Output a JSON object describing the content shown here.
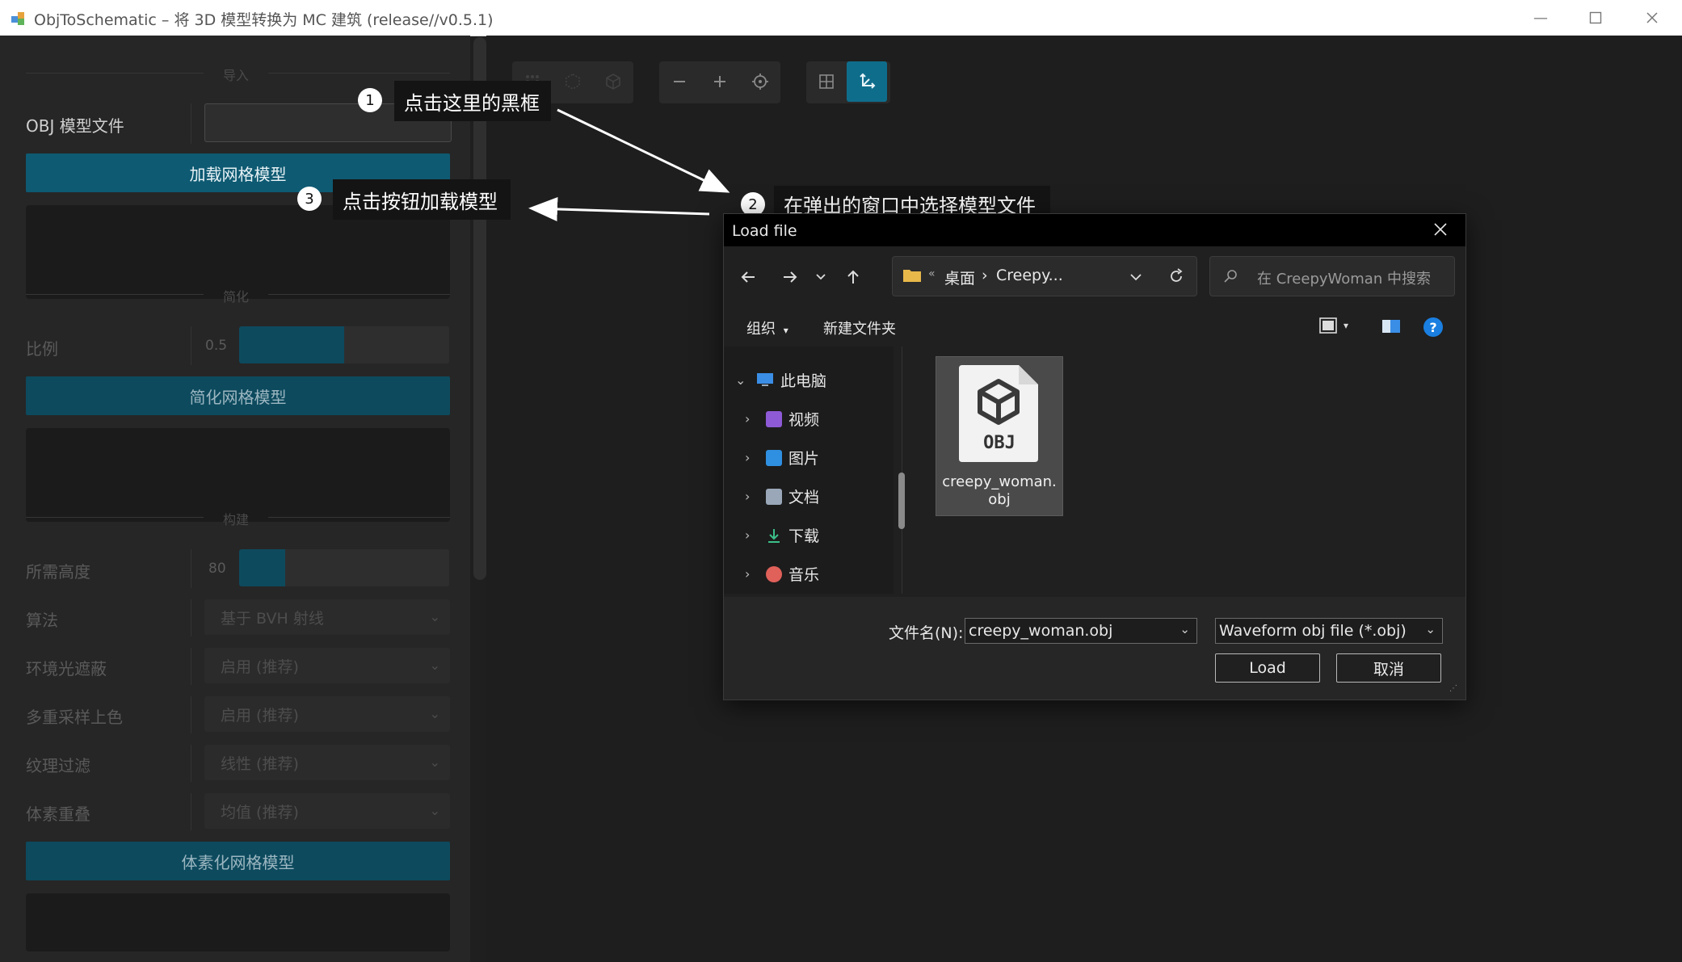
{
  "window": {
    "title": "ObjToSchematic – 将 3D 模型转换为 MC 建筑 (release//v0.5.1)",
    "minimize_icon": "minimize-icon",
    "maximize_icon": "maximize-icon",
    "close_icon": "close-icon"
  },
  "left_panel": {
    "import_section": {
      "title": "导入",
      "obj_label": "OBJ 模型文件",
      "obj_value": "",
      "load_button": "加载网格模型"
    },
    "simplify_section": {
      "title": "简化",
      "ratio_label": "比例",
      "ratio_value": "0.5",
      "ratio_fraction": 0.5,
      "simplify_button": "简化网格模型"
    },
    "build_section": {
      "title": "构建",
      "height_label": "所需高度",
      "height_value": "80",
      "height_fraction": 0.22,
      "algorithm_label": "算法",
      "algorithm_value": "基于 BVH 射线",
      "ao_label": "环境光遮蔽",
      "ao_value": "启用 (推荐)",
      "multisample_label": "多重采样上色",
      "multisample_value": "启用 (推荐)",
      "texture_filter_label": "纹理过滤",
      "texture_filter_value": "线性 (推荐)",
      "voxel_overlap_label": "体素重叠",
      "voxel_overlap_value": "均值 (推荐)",
      "voxelize_button": "体素化网格模型"
    }
  },
  "toolbar": {
    "group1": [
      "grid-dots-icon",
      "cube-dotted-icon",
      "cube-icon"
    ],
    "group2": [
      "zoom-out-icon",
      "zoom-in-icon",
      "center-target-icon"
    ],
    "group3": [
      "grid-icon",
      "axes-icon"
    ],
    "active": "axes-icon"
  },
  "annotations": {
    "step1": {
      "num": "1",
      "text": "点击这里的黑框"
    },
    "step2": {
      "num": "2",
      "text": "在弹出的窗口中选择模型文件"
    },
    "step3": {
      "num": "3",
      "text": "点击按钮加载模型"
    }
  },
  "dialog": {
    "title": "Load file",
    "breadcrumb": {
      "root": "桌面",
      "sep": "›",
      "folder": "Creepy..."
    },
    "search_placeholder": "在 CreepyWoman 中搜索",
    "organize": "组织",
    "new_folder": "新建文件夹",
    "help": "?",
    "tree": [
      {
        "label": "此电脑",
        "icon": "monitor-icon",
        "color": "#3a8ee6"
      },
      {
        "label": "视频",
        "icon": "video-icon",
        "color": "#8e5ad6"
      },
      {
        "label": "图片",
        "icon": "picture-icon",
        "color": "#2f8fe0"
      },
      {
        "label": "文档",
        "icon": "document-icon",
        "color": "#9aa7b8"
      },
      {
        "label": "下载",
        "icon": "download-icon",
        "color": "#3bbf8a"
      },
      {
        "label": "音乐",
        "icon": "music-icon",
        "color": "#e0605a"
      }
    ],
    "file": {
      "badge": "OBJ",
      "name_line1": "creepy_woman.",
      "name_line2": "obj"
    },
    "filename_label": "文件名(N):",
    "filename_value": "creepy_woman.obj",
    "filetype_value": "Waveform obj file (*.obj)",
    "load_button": "Load",
    "cancel_button": "取消"
  }
}
